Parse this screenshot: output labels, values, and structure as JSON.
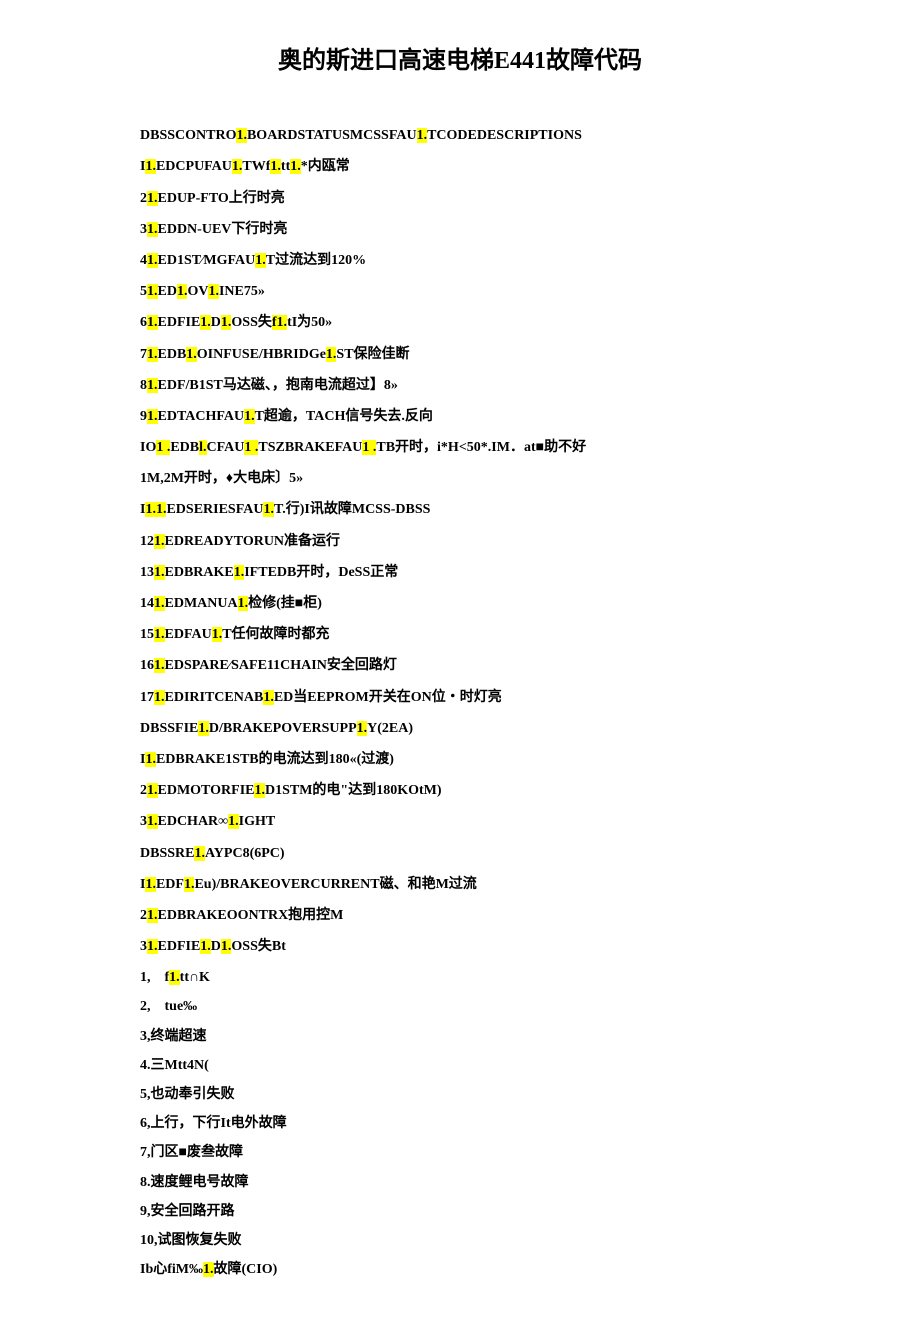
{
  "title": "奥的斯进口高速电梯E441故障代码",
  "lines": [
    {
      "pre": "DBSSCONTRO",
      "h1": "1.",
      "mid": "BOARDSTATUSMCSSFAU",
      "h2": "1.",
      "post": "TCODEDESCRIPTIONS"
    },
    {
      "pre": "I",
      "h1": "1.",
      "mid": "EDCPUFAU",
      "h2": "1.",
      "mid2": "TWf",
      "h3": "1.",
      "mid3": "tt",
      "h4": "1.",
      "post": "*内瓯常"
    },
    {
      "pre": "2",
      "h1": "1.",
      "post": "EDUP-FTO上行时亮"
    },
    {
      "pre": "3",
      "h1": "1.",
      "post": "EDDN-UEV下行时亮"
    },
    {
      "pre": "4",
      "h1": "1.",
      "mid": "ED1ST∕MGFAU",
      "h2": "1.",
      "post": "T过流达到120%"
    },
    {
      "pre": "5",
      "h1": "1.",
      "mid": "ED",
      "h2": "1.",
      "mid2": "OV",
      "h3": "1.",
      "post": "INE75»"
    },
    {
      "pre": "6",
      "h1": "1.",
      "mid": "EDFIE",
      "h2": "1.",
      "mid2": "D",
      "h3": "1.",
      "mid3": "OSS失",
      "h4": "f1.",
      "post": "tI为50»"
    },
    {
      "pre": "7",
      "h1": "1.",
      "mid": "EDB",
      "h2": "1.",
      "mid2": "OINFUSE/HBRIDGe",
      "h3": "1.",
      "post": "ST保险佳断"
    },
    {
      "pre": "8",
      "h1": "1.",
      "post": "EDF/B1ST马达磁、，抱南电流超过】8»"
    },
    {
      "pre": "9",
      "h1": "1.",
      "mid": "EDTACHFAU",
      "h2": "1.",
      "post": "T超逾，TACH信号失去.反向"
    },
    {
      "pre": "IO",
      "h1": "1 .",
      "mid": "EDB",
      "h2": "l.",
      "mid2": "CFAU",
      "h3": "1 .",
      "mid3": "TSZBRAKEFAU",
      "h4": "1 .",
      "post": "TB开时，i*H<50*.IM．at■助不好"
    },
    {
      "pre": "",
      "post": "1M,2M开时，♦大电床〕5»"
    },
    {
      "pre": "I",
      "h1": "1.1.",
      "mid": "EDSERIESFAU",
      "h2": "1.",
      "post": "T.行)I讯故障MCSS-DBSS"
    },
    {
      "pre": "12",
      "h1": "1.",
      "post": "EDREADYTORUN准备运行"
    },
    {
      "pre": "13",
      "h1": "1.",
      "mid": "EDBRAKE",
      "h2": "1.",
      "post": "IFTEDB开时，DeSS正常"
    },
    {
      "pre": "14",
      "h1": "1.",
      "mid": "EDMANUA",
      "h2": "1.",
      "post": "检修(挂■柜)"
    },
    {
      "pre": "15",
      "h1": "1.",
      "mid": "EDFAU",
      "h2": "1.",
      "post": "T任何故障时都充"
    },
    {
      "pre": "16",
      "h1": "1.",
      "post": "EDSPARE∕SAFE11CHAIN安全回路灯"
    },
    {
      "pre": "17",
      "h1": "1.",
      "mid": "EDIRITCENAB",
      "h2": "1.",
      "post": "ED当EEPROM开关在ON位・时灯亮"
    },
    {
      "pre": "DBSSFIE",
      "h1": "1.",
      "mid": "D/BRAKEPOVERSUPP",
      "h2": "1.",
      "post": "Y(2EA)"
    },
    {
      "pre": "I",
      "h1": "1.",
      "post": "EDBRAKE1STB的电流达到180«(过渡)"
    },
    {
      "pre": "2",
      "h1": "1.",
      "mid": "EDMOTORFIE",
      "h2": "1.",
      "post": "D1STM的电\"达到180KOtM)"
    },
    {
      "pre": "3",
      "h1": "1.",
      "mid": "EDCHAR∞",
      "h2": "1.",
      "post": "IGHT"
    },
    {
      "pre": "DBSSRE",
      "h1": "1.",
      "post": "AYPC8(6PC)"
    },
    {
      "pre": "I",
      "h1": "1.",
      "mid": "EDF",
      "h2": "1.",
      "post": "Eu)/BRAKEOVERCURRENT磁、和艳M过流"
    },
    {
      "pre": "2",
      "h1": "1.",
      "post": "EDBRAKEOONTRX抱用控M"
    },
    {
      "pre": "3",
      "h1": "1.",
      "mid": "EDFIE",
      "h2": "1.",
      "mid2": "D",
      "h3": "1.",
      "post": "OSS失Bt"
    }
  ],
  "numbered": [
    "1,　f1.tt∩K",
    "2,　tue‰",
    "3,终端超速",
    "4.三Mtt4N(",
    "5,也动奉引失败",
    "6,上行，下行It电外故障",
    "7,门区■废叁故障",
    "8.速度鲤电号故障",
    "9,安全回路开路",
    "10,试图恢复失败"
  ],
  "numbered_hl": {
    "pre": "1,　f",
    "h": "1.",
    "post": "tt∩K"
  },
  "lastline": {
    "pre": "Ib心fiM‰",
    "h": "1.",
    "post": "故障(CIO)"
  }
}
